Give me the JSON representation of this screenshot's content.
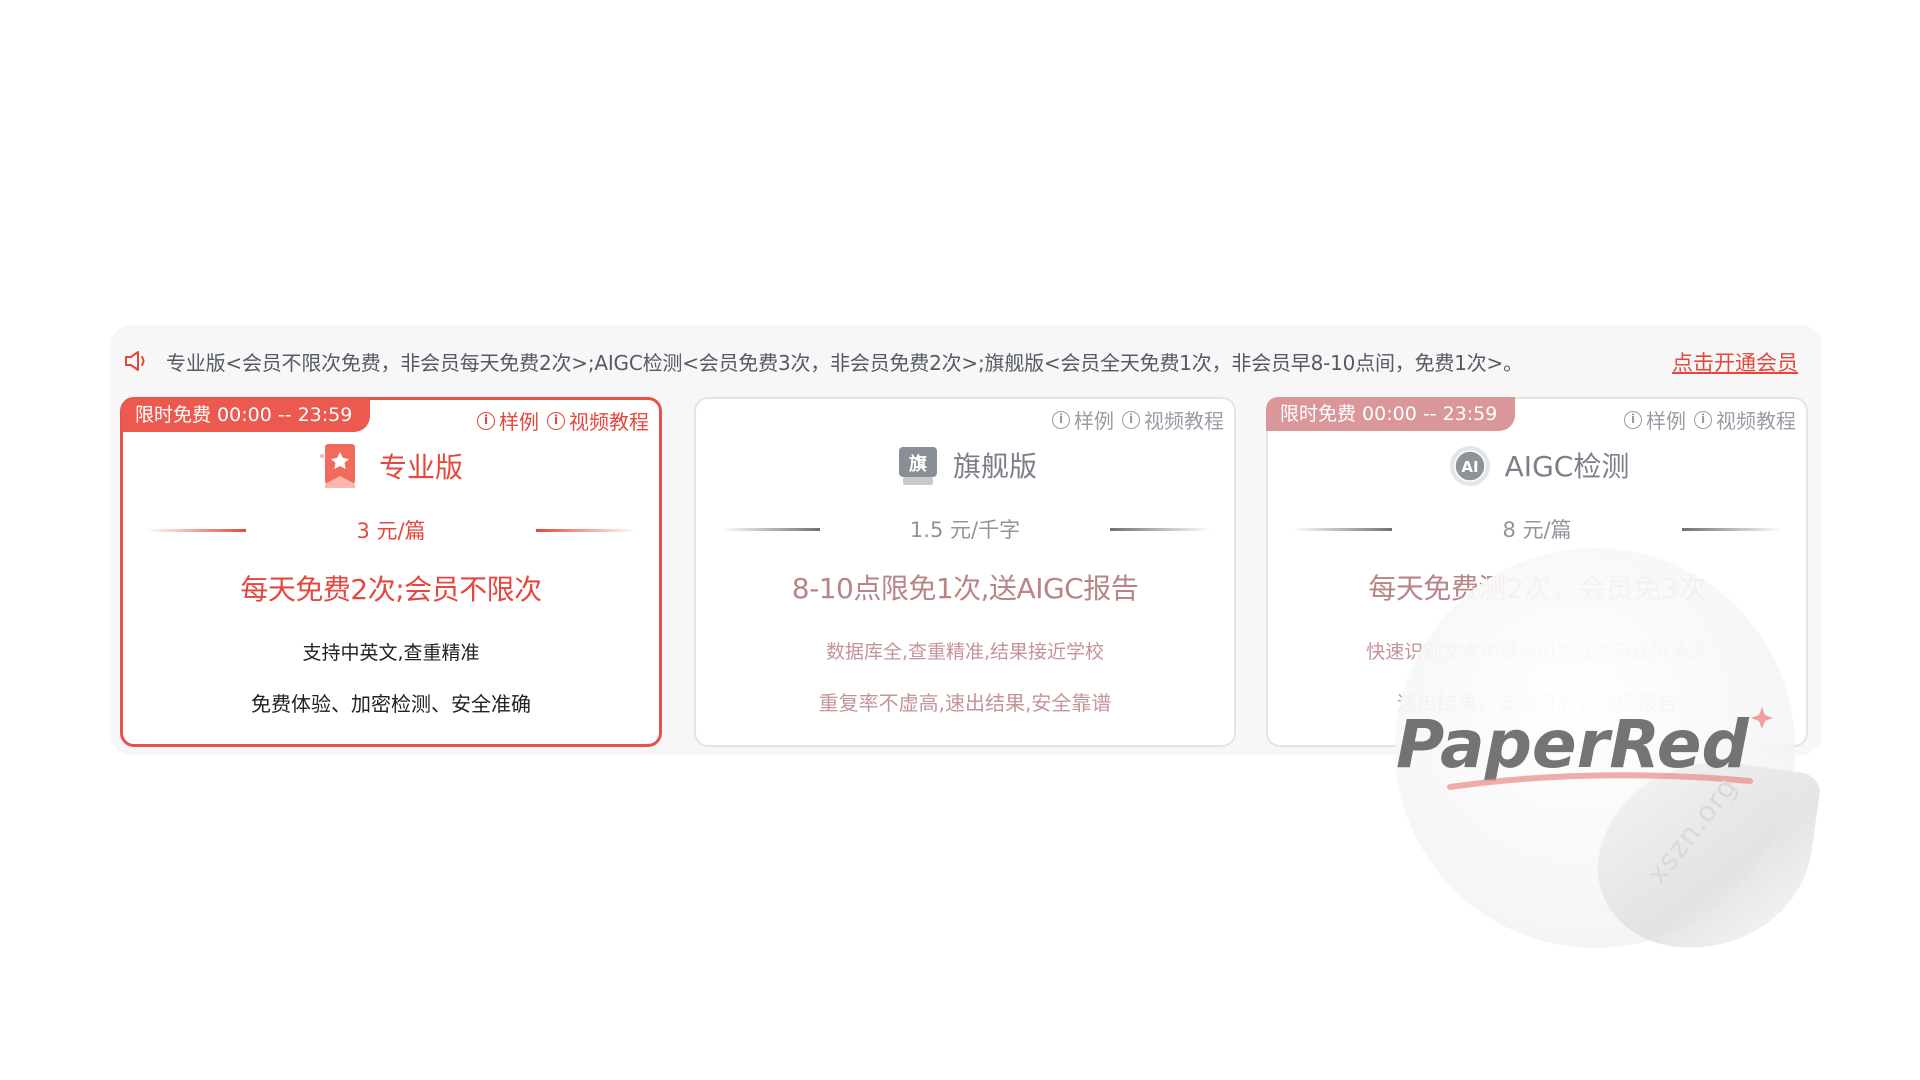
{
  "notice": {
    "icon": "speaker-icon",
    "text": "专业版<会员不限次免费，非会员每天免费2次>;AIGC检测<会员免费3次，非会员免费2次>;旗舰版<会员全天免费1次，非会员早8-10点间，免费1次>。",
    "link": "点击开通会员"
  },
  "links": {
    "sample": "样例",
    "video": "视频教程"
  },
  "cards": [
    {
      "badge": "限时免费 00:00 -- 23:59",
      "logo_icon": "bookmark-star-icon",
      "title": "专业版",
      "price": "3 元/篇",
      "headline": "每天免费2次;会员不限次",
      "line1": "支持中英文,查重精准",
      "line2": "免费体验、加密检测、安全准确"
    },
    {
      "logo_icon": "flag-chip-icon",
      "logo_text": "旗",
      "title": "旗舰版",
      "price": "1.5 元/千字",
      "headline": "8-10点限免1次,送AIGC报告",
      "line1": "数据库全,查重精准,结果接近学校",
      "line2": "重复率不虚高,速出结果,安全靠谱"
    },
    {
      "badge": "限时免费 00:00 -- 23:59",
      "logo_icon": "ai-circle-icon",
      "logo_text": "AI",
      "title": "AIGC检测",
      "price": "8 元/篇",
      "headline": "每天免费测2次，会员免3次",
      "line1": "快速识别文本中疑似AI生成内容比例多少",
      "line2": "速出结果，安全可靠，详细报告"
    }
  ],
  "watermark": {
    "logo_text": "PaperRed",
    "domain": "xszn.org"
  },
  "colors": {
    "accent": "#e6473c",
    "badge": "#ec5a4f",
    "badge_muted": "#d9979a",
    "muted_text": "#c49496"
  }
}
